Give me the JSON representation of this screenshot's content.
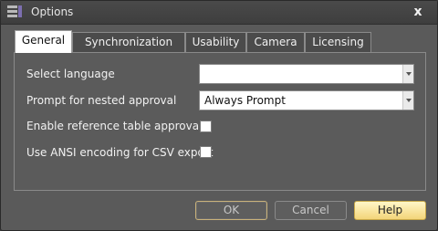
{
  "window": {
    "title": "Options",
    "close_glyph": "x"
  },
  "tabs": [
    {
      "label": "General",
      "active": true
    },
    {
      "label": "Synchronization",
      "active": false
    },
    {
      "label": "Usability",
      "active": false
    },
    {
      "label": "Camera",
      "active": false
    },
    {
      "label": "Licensing",
      "active": false
    }
  ],
  "general": {
    "select_language": {
      "label": "Select language",
      "value": ""
    },
    "prompt_nested": {
      "label": "Prompt for nested approval",
      "value": "Always Prompt"
    },
    "enable_reference": {
      "label": "Enable reference table approval",
      "checked": false
    },
    "use_ansi": {
      "label": "Use ANSI encoding for CSV export",
      "checked": false
    }
  },
  "buttons": {
    "ok": "OK",
    "cancel": "Cancel",
    "help": "Help"
  },
  "colors": {
    "help_button": "#f3d57a",
    "panel": "#5b5b5b",
    "titlebar": "#3e3e3e"
  },
  "icons": {
    "app": "list-icon",
    "close": "close-icon",
    "dropdown": "chevron-down-icon"
  }
}
